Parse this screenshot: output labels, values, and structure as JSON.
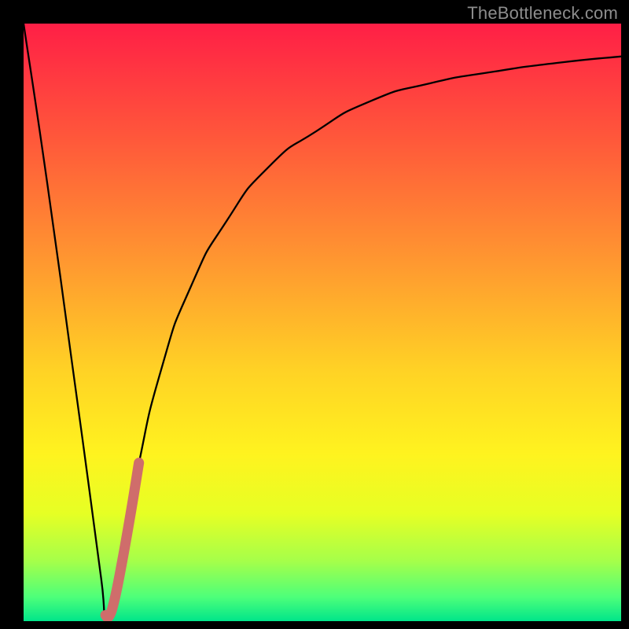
{
  "watermark": "TheBottleneck.com",
  "colors": {
    "frame": "#000000",
    "curve": "#000000",
    "highlight": "#cf6d6b",
    "gradient_stops": [
      {
        "offset": 0.0,
        "color": "#ff1f46"
      },
      {
        "offset": 0.2,
        "color": "#ff5a3a"
      },
      {
        "offset": 0.4,
        "color": "#ff9830"
      },
      {
        "offset": 0.58,
        "color": "#ffd225"
      },
      {
        "offset": 0.72,
        "color": "#fff31f"
      },
      {
        "offset": 0.82,
        "color": "#e6ff24"
      },
      {
        "offset": 0.9,
        "color": "#a5ff4a"
      },
      {
        "offset": 0.96,
        "color": "#4dff7a"
      },
      {
        "offset": 1.0,
        "color": "#00e58a"
      }
    ]
  },
  "geometry": {
    "outer_w": 800,
    "outer_h": 800,
    "inner_left": 30,
    "inner_top": 30,
    "inner_w": 760,
    "inner_h": 760
  },
  "chart_data": {
    "type": "line",
    "title": "",
    "xlabel": "",
    "ylabel": "",
    "xlim": [
      0,
      100
    ],
    "ylim": [
      0,
      100
    ],
    "series": [
      {
        "name": "main-curve",
        "color": "#000000",
        "x": [
          0,
          4,
          8,
          11,
          13,
          14,
          16,
          19,
          23,
          28,
          34,
          41,
          49,
          58,
          68,
          79,
          90,
          100
        ],
        "y": [
          100,
          73,
          44,
          22,
          7,
          0,
          9,
          25,
          42,
          56,
          67,
          76,
          82,
          87,
          90,
          92,
          93.5,
          94.5
        ]
      },
      {
        "name": "highlight-segment",
        "color": "#cf6d6b",
        "x": [
          13.7,
          14.3,
          15.2,
          16.5,
          18.0,
          19.3
        ],
        "y": [
          1.0,
          0.8,
          3.5,
          10.0,
          18.5,
          26.5
        ]
      }
    ],
    "notes": "Values are read off the plot in percent of the inner axes (0 = bottom-left, 100 = top-right). Watermark text overlays the top-right corner outside the plot border."
  }
}
